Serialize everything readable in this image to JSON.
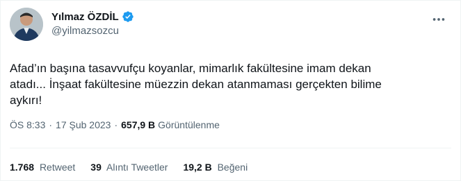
{
  "author": {
    "name": "Yılmaz ÖZDİL",
    "handle": "@yilmazsozcu",
    "verified": true
  },
  "tweet": {
    "text": "Afad’ın başına tasavvufçu koyanlar, mimarlık fakültesine imam dekan\natadı... İnşaat fakültesine müezzin dekan atanmaması gerçekten bilime\naykırı!"
  },
  "meta": {
    "time": "ÖS 8:33",
    "separator": "·",
    "date": "17 Şub 2023",
    "views_count": "657,9 B",
    "views_label": "Görüntülenme"
  },
  "stats": {
    "retweets": {
      "count": "1.768",
      "label": "Retweet"
    },
    "quotes": {
      "count": "39",
      "label": "Alıntı Tweetler"
    },
    "likes": {
      "count": "19,2 B",
      "label": "Beğeni"
    }
  },
  "colors": {
    "verified": "#1d9bf0",
    "secondary_text": "#536471",
    "primary_text": "#0f1419"
  },
  "icons": {
    "verified": "verified-badge-icon",
    "more": "more-options-icon"
  }
}
